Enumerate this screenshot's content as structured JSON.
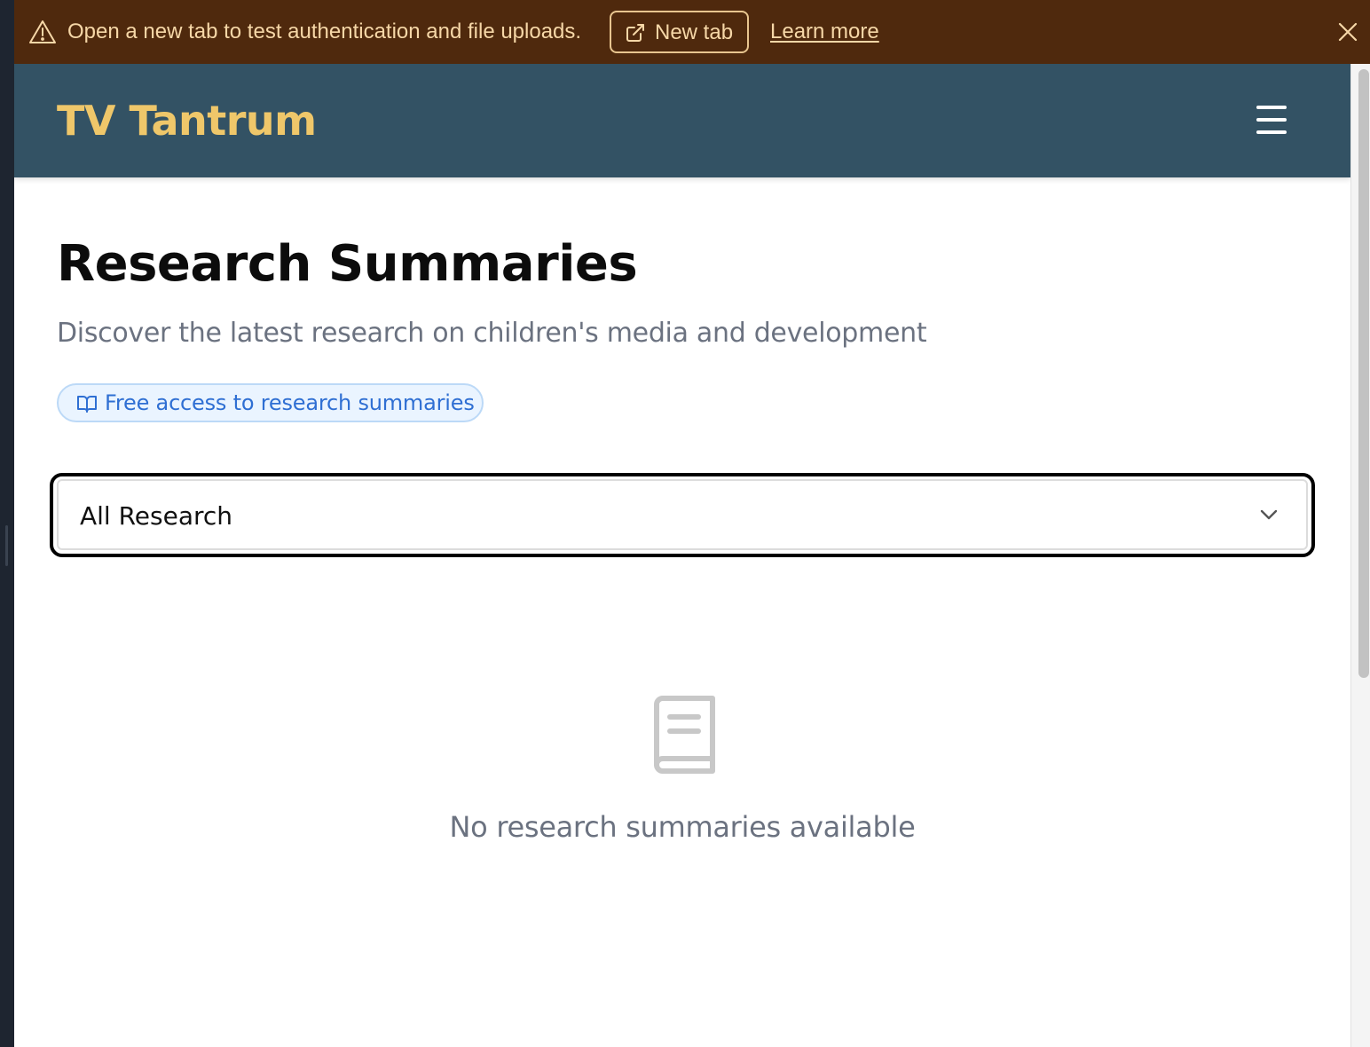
{
  "banner": {
    "message": "Open a new tab to test authentication and file uploads.",
    "new_tab_label": "New tab",
    "learn_more_label": "Learn more",
    "icons": [
      "warning-icon",
      "external-link-icon",
      "close-icon"
    ]
  },
  "header": {
    "brand": "TV Tantrum",
    "menu_icon": "hamburger-menu-icon"
  },
  "main": {
    "title": "Research Summaries",
    "subtitle": "Discover the latest research on children's media and development",
    "badge": {
      "label": "Free access to research summaries",
      "icon": "book-open-icon"
    },
    "filter": {
      "selected": "All Research",
      "icon": "chevron-down-icon"
    },
    "empty_state": {
      "icon": "book-icon",
      "message": "No research summaries available"
    }
  },
  "colors": {
    "banner_bg": "#4f290d",
    "banner_text": "#f6d7a7",
    "header_bg": "#335264",
    "brand": "#efc76a",
    "badge_bg": "#eaf4ff",
    "badge_text": "#2f6fd3",
    "muted_text": "#6b7280"
  }
}
